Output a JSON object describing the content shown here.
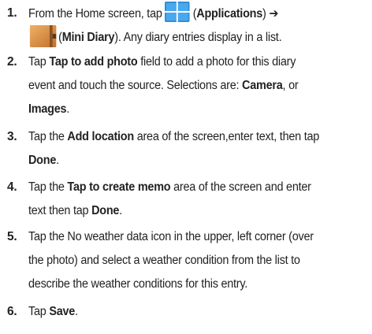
{
  "steps": [
    {
      "number": "1.",
      "part1": "From the Home screen, tap",
      "apps_label": "Applications",
      "arrow": "➔",
      "diary_label": "Mini Diary",
      "part2": ". Any diary entries display in a list."
    },
    {
      "number": "2.",
      "a": "Tap ",
      "b1": "Tap to add photo",
      "c": " field to add a photo for this diary",
      "d": "event and touch the source. Selections are: ",
      "b2": "Camera",
      "e": ", or",
      "b3": "Images",
      "f": "."
    },
    {
      "number": "3.",
      "a": "Tap the ",
      "b1": "Add location",
      "c": " area of the screen,enter text, then tap",
      "b2": "Done",
      "d": "."
    },
    {
      "number": "4.",
      "a": "Tap the ",
      "b1": "Tap to create memo",
      "c": " area of the screen and enter",
      "d": "text then tap ",
      "b2": "Done",
      "e": "."
    },
    {
      "number": "5.",
      "line1": "Tap the No weather data icon in the upper, left corner (over",
      "line2": "the photo) and select a weather condition from the list to",
      "line3": "describe the weather conditions for this entry."
    },
    {
      "number": "6.",
      "a": "Tap ",
      "b1": "Save",
      "c": "."
    }
  ],
  "icons": {
    "applications": "applications-grid-icon",
    "mini_diary": "mini-diary-icon"
  },
  "colors": {
    "text": "#222222",
    "apps_icon": "#2f8fd8",
    "diary_icon": "#d98a3c"
  }
}
